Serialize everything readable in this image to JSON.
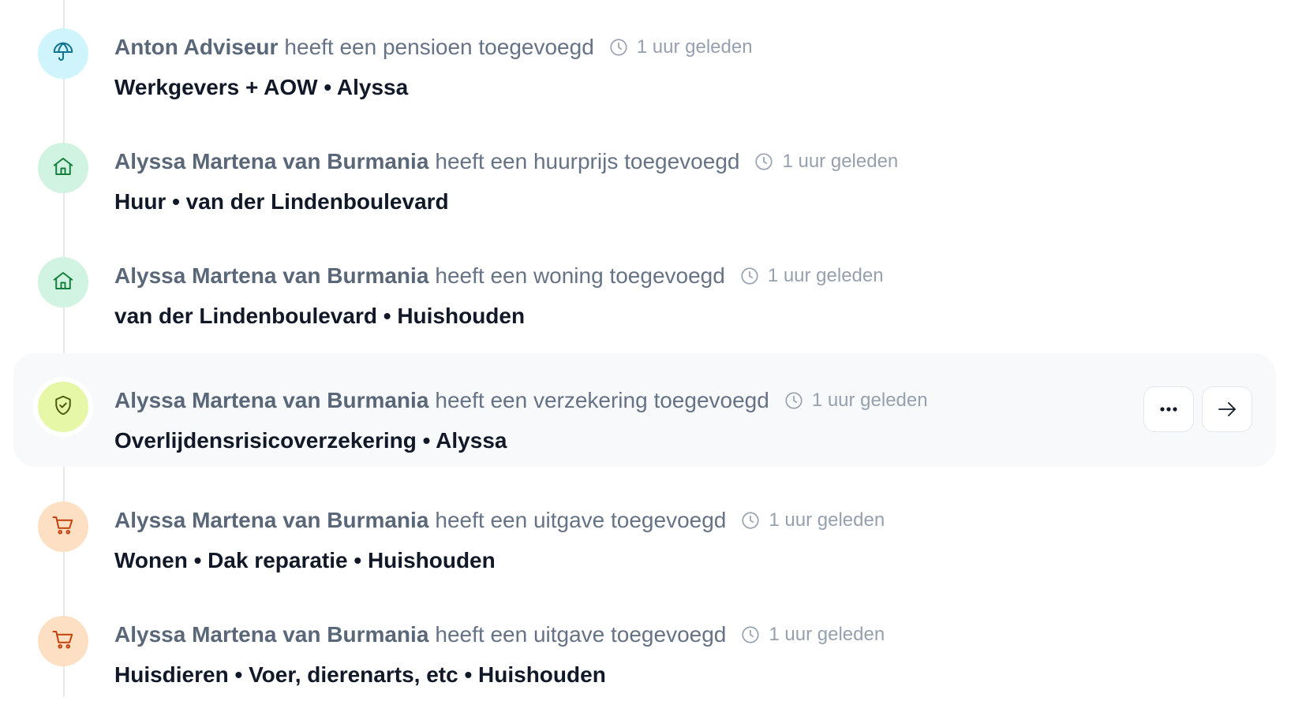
{
  "feed": {
    "items": [
      {
        "icon": "umbrella-icon",
        "accent": "#cff4fb",
        "actor": "Anton Adviseur",
        "action": "heeft een pensioen toegevoegd",
        "time": "1 uur geleden",
        "detail": "Werkgevers + AOW • Alyssa"
      },
      {
        "icon": "house-icon",
        "accent": "#d1f3e1",
        "actor": "Alyssa Martena van Burmania",
        "action": "heeft een huurprijs toegevoegd",
        "time": "1 uur geleden",
        "detail": "Huur • van der Lindenboulevard"
      },
      {
        "icon": "house-icon",
        "accent": "#d1f3e1",
        "actor": "Alyssa Martena van Burmania",
        "action": "heeft een woning toegevoegd",
        "time": "1 uur geleden",
        "detail": "van der Lindenboulevard • Huishouden"
      },
      {
        "icon": "shield-check-icon",
        "accent": "#e6f7a8",
        "actor": "Alyssa Martena van Burmania",
        "action": "heeft een verzekering toegevoegd",
        "time": "1 uur geleden",
        "detail": "Overlijdensrisicoverzekering • Alyssa",
        "highlighted": true,
        "buttons": [
          "more-icon",
          "arrow-right-icon"
        ]
      },
      {
        "icon": "cart-icon",
        "accent": "#fde0c3",
        "actor": "Alyssa Martena van Burmania",
        "action": "heeft een uitgave toegevoegd",
        "time": "1 uur geleden",
        "detail": "Wonen • Dak reparatie • Huishouden"
      },
      {
        "icon": "cart-icon",
        "accent": "#fde0c3",
        "actor": "Alyssa Martena van Burmania",
        "action": "heeft een uitgave toegevoegd",
        "time": "1 uur geleden",
        "detail": "Huisdieren • Voer, dierenarts, etc • Huishouden"
      }
    ]
  }
}
